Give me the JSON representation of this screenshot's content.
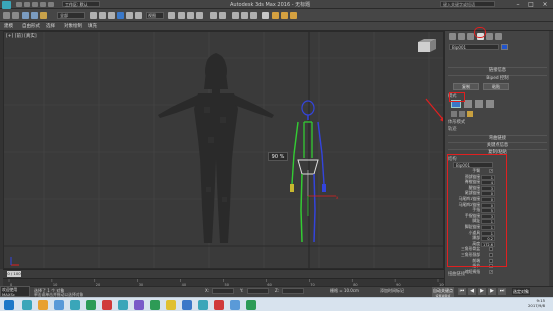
{
  "title_bar": {
    "title": "Autodesk 3ds Max 2016 - 无标题",
    "workspace": "工作区: 默认",
    "search_placeholder": "键入关键字或短语",
    "minimize": "–",
    "maximize": "□",
    "close": "×"
  },
  "toolbar": {
    "selection_filter": "全部",
    "view_dropdown": "视图"
  },
  "menu": {
    "items": [
      "建模",
      "自由形式",
      "选择",
      "对象绘制",
      "填充"
    ]
  },
  "viewport": {
    "label": "[+] [前] [真实]",
    "zoom_percent": "90 %"
  },
  "command_panel": {
    "tabs": [
      "create-icon",
      "modify-icon",
      "hierarchy-icon",
      "motion-icon",
      "display-icon",
      "utilities-icon"
    ],
    "name_field": "Bip001",
    "color": "#2255cc",
    "rollout_link_info": "链接信息",
    "rollout_ik": "Biped 控制",
    "btn_copy": "复制",
    "btn_paste": "粘贴",
    "section_mode": "模式",
    "section_figure_mode": "体形模式",
    "section_track": "轨迹",
    "section_bend": "弯曲链接",
    "section_keyframe": "关键点信息",
    "section_copy_paste": "复制/粘贴",
    "section_structure": "结构",
    "structure_dropdown": "Bip001",
    "params": [
      {
        "label": "手臂",
        "value": "✓",
        "type": "check"
      },
      {
        "label": "颈部链接",
        "value": "1",
        "type": "num"
      },
      {
        "label": "脊椎链接",
        "value": "4",
        "type": "num"
      },
      {
        "label": "腿链接",
        "value": "3",
        "type": "num"
      },
      {
        "label": "尾部链接",
        "value": "0",
        "type": "num"
      },
      {
        "label": "马尾辫1链接",
        "value": "0",
        "type": "num"
      },
      {
        "label": "马尾辫2链接",
        "value": "0",
        "type": "num"
      },
      {
        "label": "手指",
        "value": "5",
        "type": "num"
      },
      {
        "label": "手指链接",
        "value": "3",
        "type": "num"
      },
      {
        "label": "脚趾",
        "value": "1",
        "type": "num"
      },
      {
        "label": "脚趾链接",
        "value": "1",
        "type": "num"
      },
      {
        "label": "小道具",
        "value": "1",
        "type": "num"
      },
      {
        "label": "踝部",
        "value": "0.2",
        "type": "num"
      },
      {
        "label": "高度",
        "value": "172.6",
        "type": "num"
      },
      {
        "label": "三角形骨盆",
        "value": "",
        "type": "check"
      },
      {
        "label": "三角形颈部",
        "value": "",
        "type": "check"
      },
      {
        "label": "前端",
        "value": "",
        "type": "check"
      },
      {
        "label": "指节",
        "value": "",
        "type": "check"
      },
      {
        "label": "缩短拇指",
        "value": "✓",
        "type": "check"
      }
    ],
    "bottom_label": "扭曲链接"
  },
  "timeline": {
    "slider": "0 / 100",
    "ticks": [
      "0",
      "10",
      "20",
      "30",
      "40",
      "50",
      "60",
      "70",
      "80",
      "90",
      "100"
    ]
  },
  "status": {
    "maxscript": "欢迎使用 MAXSc",
    "message": "选择了 1 个 对象",
    "hint": "单击或单击并拖动以选择对象",
    "x_label": "X:",
    "y_label": "Y:",
    "z_label": "Z:",
    "x_value": "",
    "y_value": "",
    "z_value": "",
    "grid": "栅格 = 10.0cm",
    "add_time_tag": "添加时间标记",
    "auto_key": "自动关键点",
    "set_key": "设置关键点",
    "selected": "选定对象"
  },
  "taskbar": {
    "time": "9:15",
    "date": "2017/9/8"
  },
  "colors": {
    "annotation_red": "#e02020",
    "skeleton_green": "#33cc33",
    "skeleton_blue": "#3344dd"
  }
}
